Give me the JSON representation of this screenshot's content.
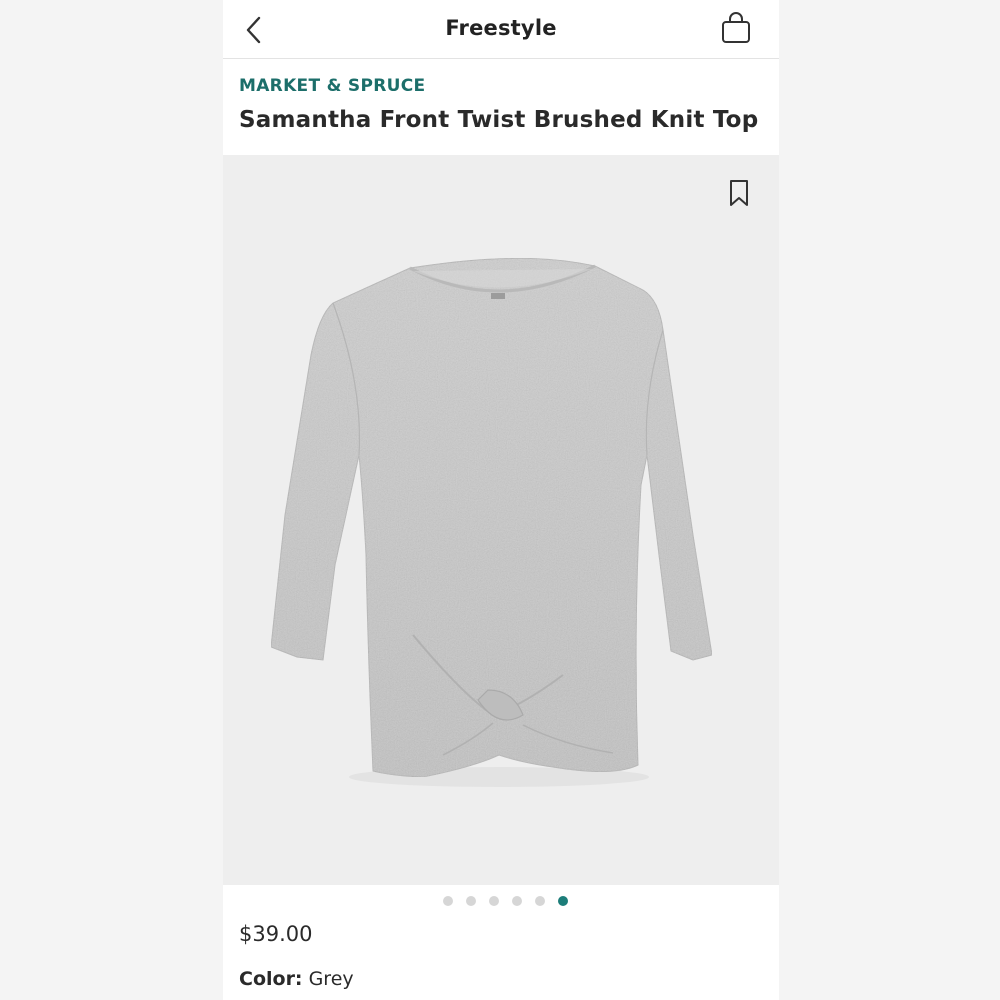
{
  "nav": {
    "title": "Freestyle",
    "back_icon": "chevron-left-icon",
    "bag_icon": "shopping-bag-icon"
  },
  "product": {
    "brand": "MARKET & SPRUCE",
    "name": "Samantha Front Twist Brushed Knit Top",
    "price": "$39.00",
    "color_label": "Color:",
    "color_value": "Grey",
    "bookmark_icon": "bookmark-icon"
  },
  "carousel": {
    "total": 6,
    "active_index": 5
  },
  "colors": {
    "brand": "#1c6e6a",
    "active_dot": "#1c7d79",
    "inactive_dot": "#d6d6d6",
    "garment": "#c9c9c9"
  }
}
